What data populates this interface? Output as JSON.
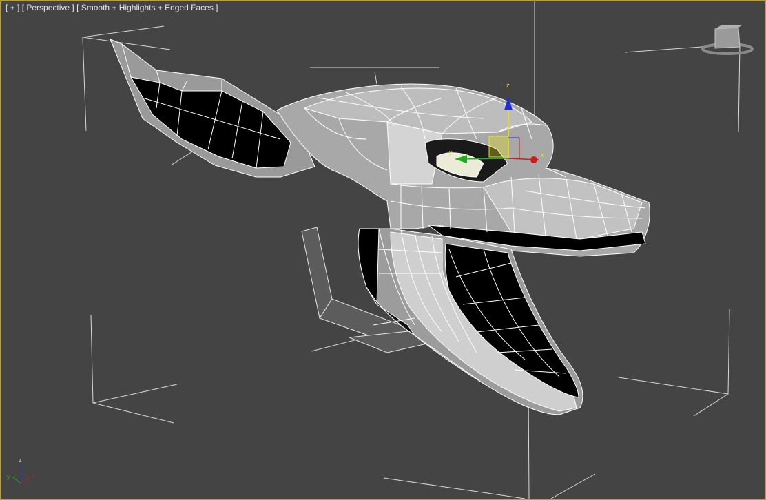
{
  "viewport": {
    "menu_plus": "[ + ]",
    "view_name": "[ Perspective ]",
    "shading_mode": "[ Smooth + Highlights + Edged Faces ]"
  },
  "gizmo": {
    "z_label": "z",
    "x_label": "x",
    "y_label": "y"
  },
  "axis_tripod": {
    "z_label": "z",
    "x_label": "x",
    "y_label": "y"
  },
  "colors": {
    "viewport_bg": "#444444",
    "active_border": "#b5a04a",
    "axis_x": "#c81e1e",
    "axis_y": "#1fae1f",
    "axis_z": "#1e2fd6",
    "gizmo_yellow": "#e8e020"
  }
}
